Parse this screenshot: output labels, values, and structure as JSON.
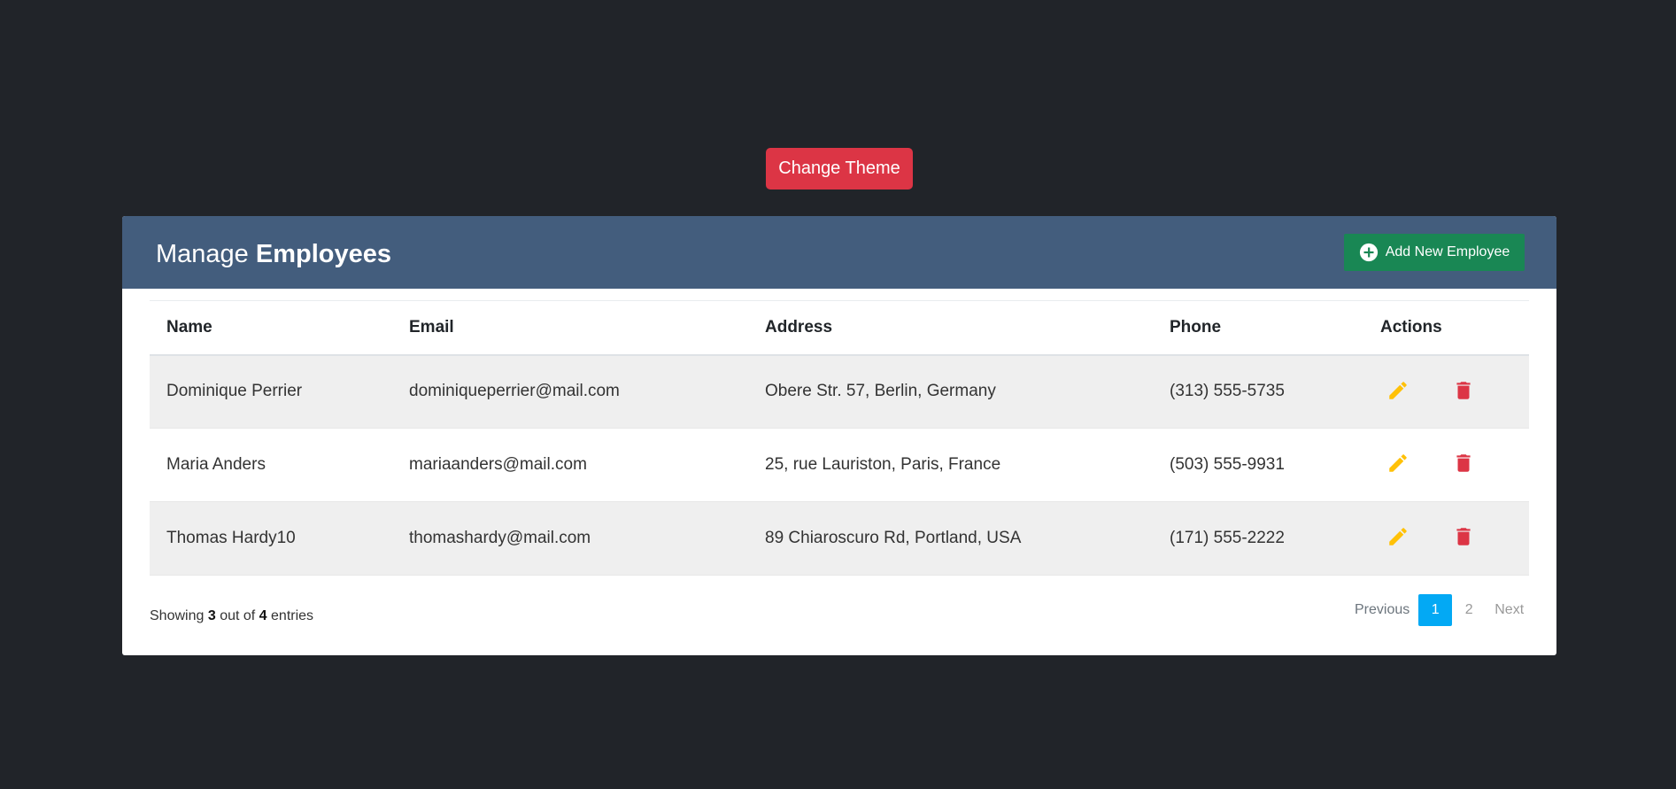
{
  "theme_button": {
    "label": "Change Theme"
  },
  "panel": {
    "title_prefix": "Manage",
    "title_bold": "Employees",
    "add_button_label": "Add New Employee"
  },
  "table": {
    "headers": {
      "name": "Name",
      "email": "Email",
      "address": "Address",
      "phone": "Phone",
      "actions": "Actions"
    },
    "rows": [
      {
        "name": "Dominique Perrier",
        "email": "dominiqueperrier@mail.com",
        "address": "Obere Str. 57, Berlin, Germany",
        "phone": "(313) 555-5735"
      },
      {
        "name": "Maria Anders",
        "email": "mariaanders@mail.com",
        "address": "25, rue Lauriston, Paris, France",
        "phone": "(503) 555-9931"
      },
      {
        "name": "Thomas Hardy10",
        "email": "thomashardy@mail.com",
        "address": "89 Chiaroscuro Rd, Portland, USA",
        "phone": "(171) 555-2222"
      }
    ]
  },
  "footer": {
    "showing_prefix": "Showing",
    "shown_count": "3",
    "out_of": "out of",
    "total_count": "4",
    "entries": "entries"
  },
  "pagination": {
    "previous": "Previous",
    "pages": [
      "1",
      "2"
    ],
    "active_page": "1",
    "next": "Next"
  },
  "icons": {
    "add": "plus-circle-icon",
    "edit": "pencil-icon",
    "delete": "trash-icon"
  },
  "colors": {
    "background": "#212429",
    "theme_button": "#dc3545",
    "header": "#435d7d",
    "add_button": "#198754",
    "edit_icon": "#ffc107",
    "delete_icon": "#dc3545",
    "active_page": "#03a9f4"
  }
}
